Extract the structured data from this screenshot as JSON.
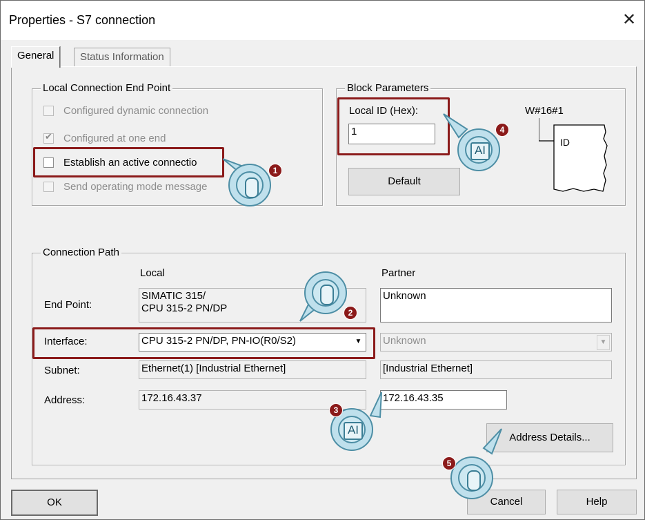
{
  "window": {
    "title": "Properties - S7 connection",
    "close_glyph": "✕"
  },
  "tabs": [
    {
      "label": "General",
      "active": true
    },
    {
      "label": "Status Information",
      "active": false
    }
  ],
  "local_end_point": {
    "title": "Local Connection End Point",
    "configured_dynamic": {
      "label": "Configured dynamic connection",
      "checked": false,
      "enabled": false
    },
    "configured_one_end": {
      "label": "Configured at one end",
      "checked": true,
      "enabled": false
    },
    "active_connection": {
      "label": "Establish an active connectio",
      "checked": false,
      "enabled": true
    },
    "send_mode": {
      "label": "Send operating mode message",
      "checked": false,
      "enabled": false
    }
  },
  "block_params": {
    "title": "Block Parameters",
    "local_id_label": "Local ID (Hex):",
    "local_id_value": "1",
    "default_button": "Default",
    "w_label": "W#16#1",
    "id_label": "ID"
  },
  "connection_path": {
    "title": "Connection Path",
    "local_header": "Local",
    "partner_header": "Partner",
    "end_point_label": "End Point:",
    "end_point_local_line1": "SIMATIC 315/",
    "end_point_local_line2": "CPU 315-2 PN/DP",
    "end_point_partner": "Unknown",
    "interface_label": "Interface:",
    "interface_local": "CPU 315-2 PN/DP, PN-IO(R0/S2)",
    "interface_partner": "Unknown",
    "subnet_label": "Subnet:",
    "subnet_local": "Ethernet(1) [Industrial Ethernet]",
    "subnet_partner": "[Industrial Ethernet]",
    "address_label": "Address:",
    "address_local": "172.16.43.37",
    "address_partner": "172.16.43.35",
    "address_details_button": "Address Details..."
  },
  "footer": {
    "ok": "OK",
    "cancel": "Cancel",
    "help": "Help"
  },
  "annotations": [
    {
      "number": "1",
      "icon": "mouse-click-icon"
    },
    {
      "number": "2",
      "icon": "mouse-click-icon"
    },
    {
      "number": "3",
      "icon": "text-input-icon",
      "glyph": "AI"
    },
    {
      "number": "4",
      "icon": "text-input-icon",
      "glyph": "AI"
    },
    {
      "number": "5",
      "icon": "mouse-click-icon"
    }
  ],
  "colors": {
    "highlight": "#8b1a1a",
    "callout_fill": "#bfe0ec",
    "callout_stroke": "#4d8ea5"
  }
}
